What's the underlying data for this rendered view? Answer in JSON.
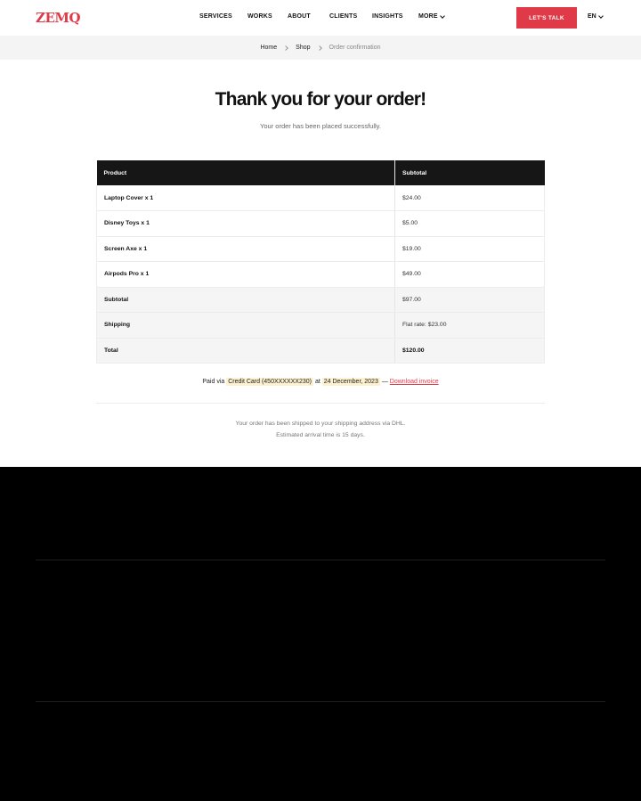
{
  "header": {
    "logo": "ZEMQ",
    "nav": [
      "SERVICES",
      "WORKS",
      "ABOUT",
      "CLIENTS",
      "INSIGHTS",
      "MORE"
    ],
    "cta": "LET'S TALK",
    "lang": "EN"
  },
  "breadcrumb": [
    "Home",
    "Shop",
    "Order confirmation"
  ],
  "page": {
    "title": "Thank you for your order!",
    "subtitle": "Your order has been placed successfully."
  },
  "table": {
    "headers": [
      "Product",
      "Subtotal"
    ],
    "items": [
      {
        "name": "Laptop Cover x 1",
        "price": "$24.00"
      },
      {
        "name": "Disney Toys x 1",
        "price": "$5.00"
      },
      {
        "name": "Screen Axe x 1",
        "price": "$19.00"
      },
      {
        "name": "Airpods Pro x 1",
        "price": "$49.00"
      }
    ],
    "summary": [
      {
        "name": "Subtotal",
        "price": "$97.00"
      },
      {
        "name": "Shipping",
        "price": "Flat rate: $23.00"
      },
      {
        "name": "Total",
        "price": "$120.00"
      }
    ]
  },
  "payment": {
    "prefix": "Paid via",
    "method": "Credit Card (450XXXXXX230)",
    "at": "at",
    "date": "24 December, 2023",
    "dash": "—",
    "invoice_link": "Download invoice"
  },
  "shipping_note": {
    "line1": "Your order has been shipped to your shipping address via DHL.",
    "line2": "Estimated arrival time is 15 days."
  },
  "colors": {
    "accent": "#e03a48",
    "table_header": "#161616",
    "highlight": "#fdf1cf",
    "footer": "#000000"
  }
}
